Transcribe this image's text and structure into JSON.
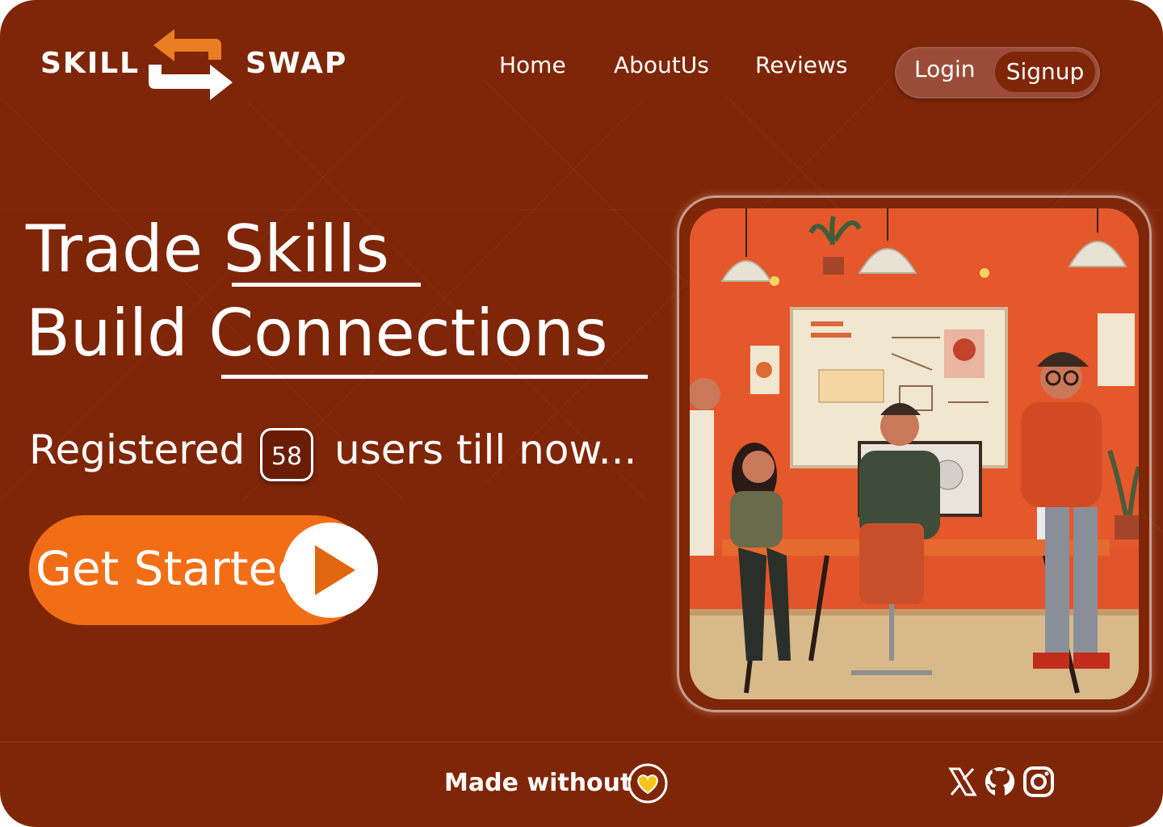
{
  "logo": {
    "left_word": "SKILL",
    "right_word": "SWAP"
  },
  "nav": {
    "home": "Home",
    "about": "AboutUs",
    "reviews": "Reviews"
  },
  "auth": {
    "login": "Login",
    "signup": "Signup"
  },
  "hero": {
    "line1_plain": "Trade ",
    "line1_key": "Skills",
    "line2_plain": "Build ",
    "line2_key": "Connections"
  },
  "registered": {
    "prefix": "Registered",
    "count": "58",
    "suffix": "users till now..."
  },
  "cta": {
    "label": "Get Started"
  },
  "footer": {
    "made_without": "Made without"
  },
  "social": [
    "x-icon",
    "github-icon",
    "instagram-icon"
  ],
  "colors": {
    "background": "#7f2608",
    "accent": "#f26e16",
    "logo_arrow_orange": "#e87d22",
    "heart": "#f5c518"
  }
}
